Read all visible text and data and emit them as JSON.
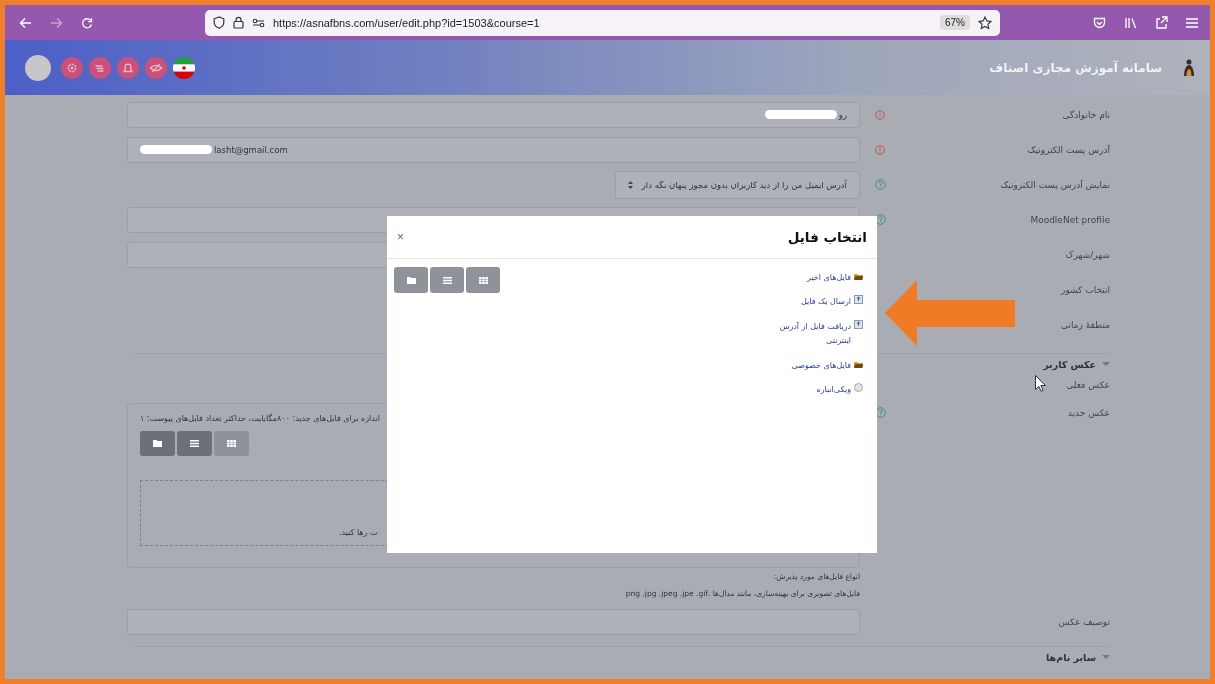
{
  "browser": {
    "url": "https://asnafbns.com/user/edit.php?id=1503&course=1",
    "zoom": "67%",
    "forward_enabled": false
  },
  "header": {
    "site_title": "سامانه آموزش مجازی اصناف"
  },
  "form": {
    "rows": [
      {
        "kind": "input",
        "label": "نام خانوادگی",
        "value": "رو",
        "redacted": true,
        "required": true
      },
      {
        "kind": "email",
        "label": "آدرس پست الکترونیک",
        "value": "lasht@gmail.com",
        "redacted": true,
        "required": true
      },
      {
        "kind": "select",
        "label": "نمایش آدرس پست الکترونیک",
        "value": "آدرس ایمیل من را از دید کاربران بدون مجوز پنهان نگه دار",
        "help": true
      },
      {
        "kind": "input",
        "label": "MoodleNet profile",
        "help": true
      },
      {
        "kind": "input",
        "label": "شهر/شهرک"
      },
      {
        "kind": "covered",
        "label": "انتخاب کشور"
      },
      {
        "kind": "covered",
        "label": "منطقهٔ زمانی"
      }
    ]
  },
  "photo_section": {
    "title": "عکس کاربر",
    "expanded": true,
    "current_label": "عکس فعلی",
    "new_label": "عکس جدید",
    "limits": "اندازه برای فایل‌های جدید: ۸۰۰مگابایت، حداکثر تعداد فایل‌های پیوست: ۱",
    "view_buttons": [
      {
        "selected": false
      },
      {
        "selected": false
      },
      {
        "selected": true
      }
    ],
    "drop_hint": "ت رها کنید.",
    "accepted_title": "انواع فایل‌های مورد پذیرش:",
    "accepted_types": "فایل‌های تصویری برای بهینه‌سازی، مانند مدال‌ها .png .jpg .jpeg .jpe .gif",
    "description_label": "توصیف عکس"
  },
  "other_section": {
    "title": "سایر نام‌ها",
    "expanded": true
  },
  "modal": {
    "title": "انتخاب فایل",
    "close": "×",
    "repositories": [
      {
        "label": "فایل‌های اخیر",
        "kind": "folder"
      },
      {
        "label": "ارسال یک فایل",
        "kind": "upload"
      },
      {
        "label": "دریافت فایل از آدرس اینترنتی",
        "kind": "upload"
      },
      {
        "label": "فایل‌های خصوصی",
        "kind": "folder"
      },
      {
        "label": "ویکی‌انباره",
        "kind": "wiki"
      }
    ],
    "view_buttons": [
      {
        "selected": false
      },
      {
        "selected": false
      },
      {
        "selected": false
      }
    ]
  }
}
